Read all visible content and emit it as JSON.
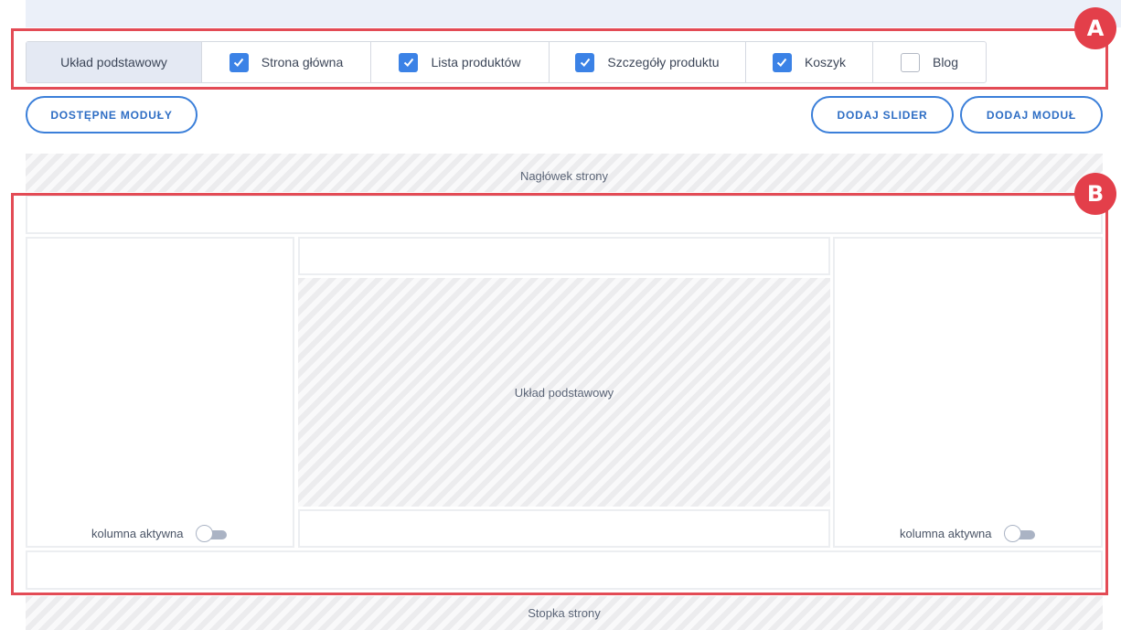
{
  "tabs": [
    {
      "label": "Układ podstawowy",
      "checkbox": null,
      "active": true
    },
    {
      "label": "Strona główna",
      "checkbox": true,
      "active": false
    },
    {
      "label": "Lista produktów",
      "checkbox": true,
      "active": false
    },
    {
      "label": "Szczegóły produktu",
      "checkbox": true,
      "active": false
    },
    {
      "label": "Koszyk",
      "checkbox": true,
      "active": false
    },
    {
      "label": "Blog",
      "checkbox": false,
      "active": false
    }
  ],
  "buttons": {
    "available_modules": "DOSTĘPNE MODUŁY",
    "add_slider": "DODAJ SLIDER",
    "add_module": "DODAJ MODUŁ"
  },
  "layout": {
    "header_label": "Nagłówek strony",
    "center_label": "Układ podstawowy",
    "left_column_toggle_label": "kolumna aktywna",
    "right_column_toggle_label": "kolumna aktywna",
    "footer_label": "Stopka strony"
  },
  "annotations": {
    "badge_a": "A",
    "badge_b": "B"
  },
  "colors": {
    "accent": "#3b82e6",
    "annotation": "#e34b55"
  }
}
